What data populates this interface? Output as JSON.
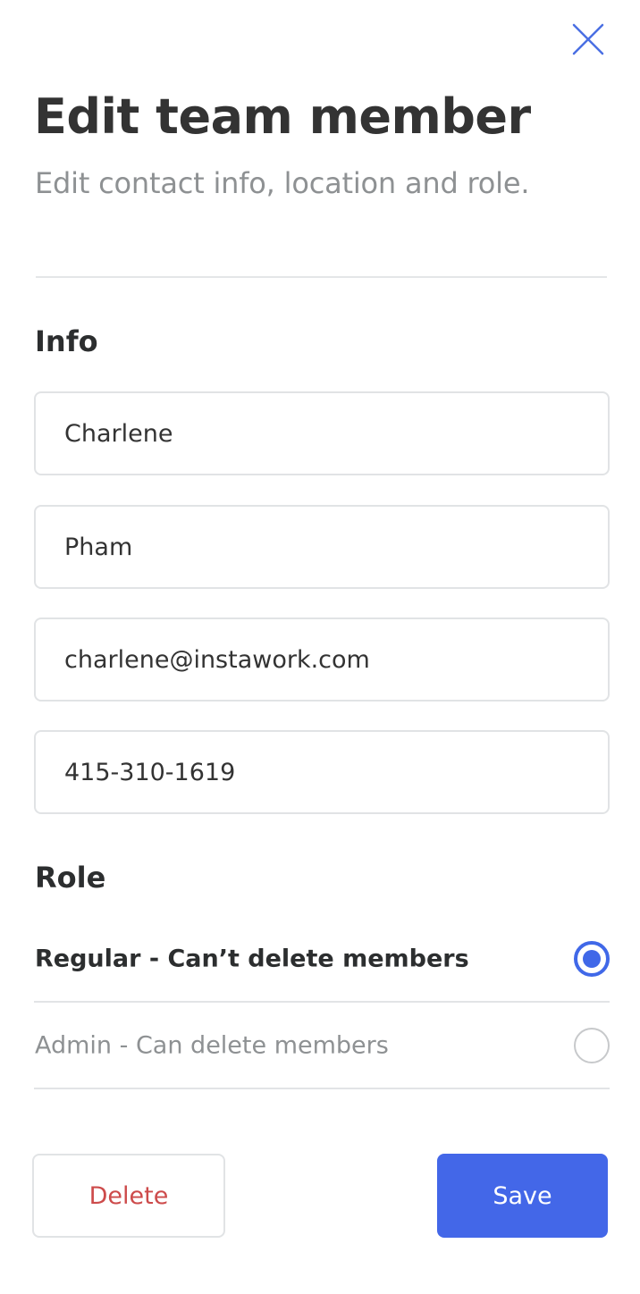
{
  "header": {
    "title": "Edit team member",
    "subtitle": "Edit contact info, location and role.",
    "close_icon": "close-icon"
  },
  "info": {
    "heading": "Info",
    "first_name": "Charlene",
    "last_name": "Pham",
    "email": "charlene@instawork.com",
    "phone": "415-310-1619"
  },
  "role": {
    "heading": "Role",
    "options": [
      {
        "label": "Regular - Can’t delete members",
        "selected": true
      },
      {
        "label": "Admin - Can delete members",
        "selected": false
      }
    ]
  },
  "actions": {
    "delete_label": "Delete",
    "save_label": "Save"
  },
  "colors": {
    "accent": "#4367e8",
    "danger": "#cd4b4b",
    "muted_text": "#8e9193",
    "border": "#e1e3e5"
  }
}
